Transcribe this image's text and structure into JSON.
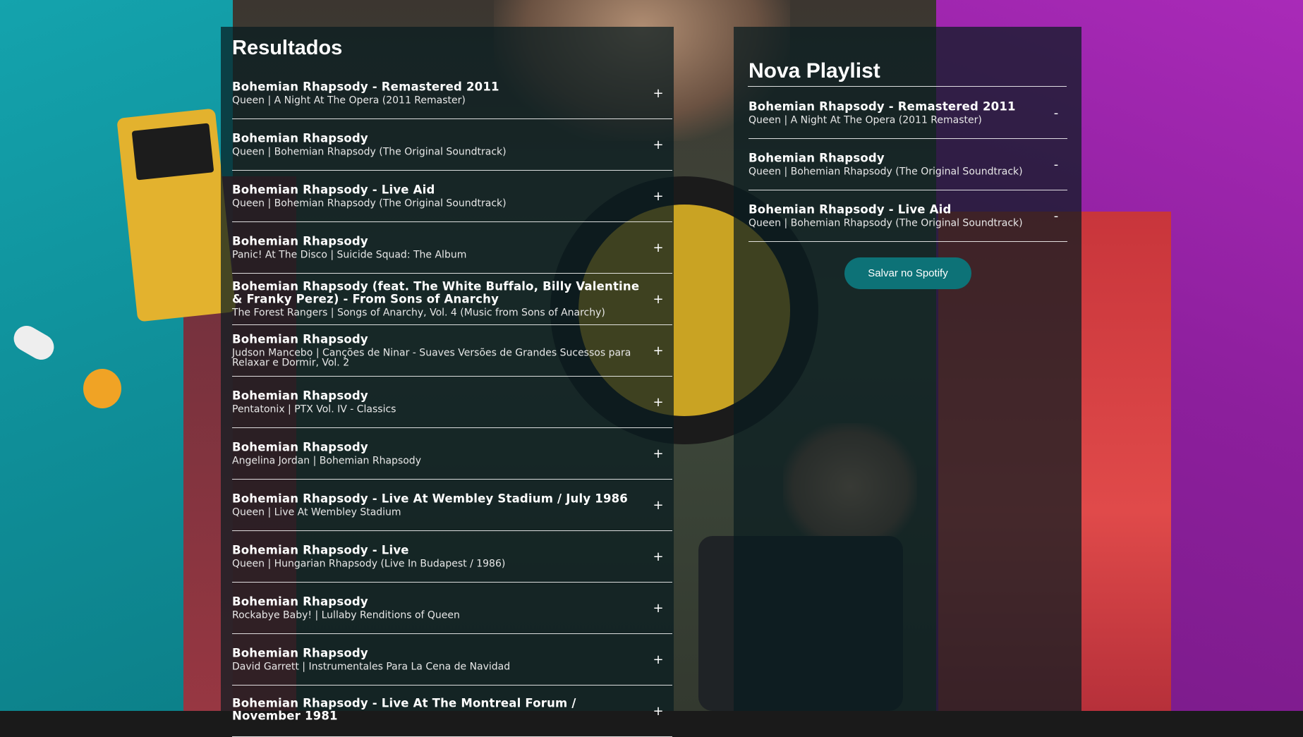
{
  "results": {
    "title": "Resultados",
    "tracks": [
      {
        "title": "Bohemian Rhapsody - Remastered 2011",
        "subtitle": "Queen | A Night At The Opera (2011 Remaster)",
        "action": "+"
      },
      {
        "title": "Bohemian Rhapsody",
        "subtitle": "Queen | Bohemian Rhapsody (The Original Soundtrack)",
        "action": "+"
      },
      {
        "title": "Bohemian Rhapsody - Live Aid",
        "subtitle": "Queen | Bohemian Rhapsody (The Original Soundtrack)",
        "action": "+"
      },
      {
        "title": "Bohemian Rhapsody",
        "subtitle": "Panic! At The Disco | Suicide Squad: The Album",
        "action": "+"
      },
      {
        "title": "Bohemian Rhapsody (feat. The White Buffalo, Billy Valentine & Franky Perez) - From Sons of Anarchy",
        "subtitle": "The Forest Rangers | Songs of Anarchy, Vol. 4 (Music from Sons of Anarchy)",
        "action": "+"
      },
      {
        "title": "Bohemian Rhapsody",
        "subtitle": "Judson Mancebo | Canções de Ninar - Suaves Versões de Grandes Sucessos para Relaxar e Dormir, Vol. 2",
        "action": "+"
      },
      {
        "title": "Bohemian Rhapsody",
        "subtitle": "Pentatonix | PTX Vol. IV - Classics",
        "action": "+"
      },
      {
        "title": "Bohemian Rhapsody",
        "subtitle": "Angelina Jordan | Bohemian Rhapsody",
        "action": "+"
      },
      {
        "title": "Bohemian Rhapsody - Live At Wembley Stadium / July 1986",
        "subtitle": "Queen | Live At Wembley Stadium",
        "action": "+"
      },
      {
        "title": "Bohemian Rhapsody - Live",
        "subtitle": "Queen | Hungarian Rhapsody (Live In Budapest / 1986)",
        "action": "+"
      },
      {
        "title": "Bohemian Rhapsody",
        "subtitle": "Rockabye Baby! | Lullaby Renditions of Queen",
        "action": "+"
      },
      {
        "title": "Bohemian Rhapsody",
        "subtitle": "David Garrett | Instrumentales Para La Cena de Navidad",
        "action": "+"
      },
      {
        "title": "Bohemian Rhapsody - Live At The Montreal Forum / November 1981",
        "subtitle": "",
        "action": "+"
      }
    ]
  },
  "playlist": {
    "title": "Nova Playlist",
    "tracks": [
      {
        "title": "Bohemian Rhapsody - Remastered 2011",
        "subtitle": "Queen | A Night At The Opera (2011 Remaster)",
        "action": "-"
      },
      {
        "title": "Bohemian Rhapsody",
        "subtitle": "Queen | Bohemian Rhapsody (The Original Soundtrack)",
        "action": "-"
      },
      {
        "title": "Bohemian Rhapsody - Live Aid",
        "subtitle": "Queen | Bohemian Rhapsody (The Original Soundtrack)",
        "action": "-"
      }
    ],
    "save_label": "Salvar no Spotify"
  },
  "colors": {
    "panel_bg": "#081c20",
    "save_button": "#0d7277",
    "text": "#ffffff"
  }
}
